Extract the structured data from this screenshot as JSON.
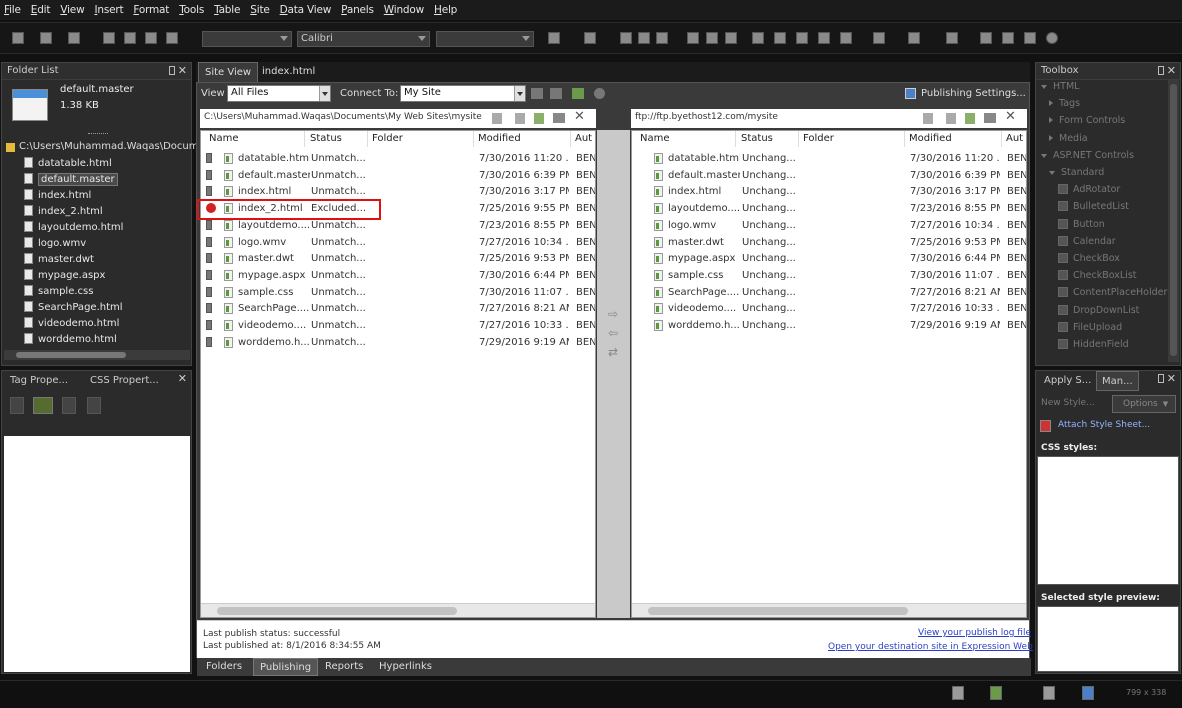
{
  "menu": [
    "File",
    "Edit",
    "View",
    "Insert",
    "Format",
    "Tools",
    "Table",
    "Site",
    "Data View",
    "Panels",
    "Window",
    "Help"
  ],
  "toolbar": {
    "font_name": "Calibri"
  },
  "folder_list": {
    "title": "Folder List",
    "selected_name": "default.master",
    "selected_size": "1.38 KB",
    "root_path": "C:\\Users\\Muhammad.Waqas\\Documents",
    "items": [
      "datatable.html",
      "default.master",
      "index.html",
      "index_2.html",
      "layoutdemo.html",
      "logo.wmv",
      "master.dwt",
      "mypage.aspx",
      "sample.css",
      "SearchPage.html",
      "videodemo.html",
      "worddemo.html"
    ]
  },
  "tag_panel": {
    "tab1": "Tag Prope...",
    "tab2": "CSS Propert..."
  },
  "tabs": {
    "site_view": "Site View",
    "index": "index.html"
  },
  "view_bar": {
    "view_label": "View",
    "view_value": "All Files",
    "connect_label": "Connect To:",
    "connect_value": "My Site",
    "publishing_settings": "Publishing Settings..."
  },
  "local": {
    "path": "C:\\Users\\Muhammad.Waqas\\Documents\\My Web Sites\\mysite",
    "headers": [
      "Name",
      "Status",
      "Folder",
      "Modified",
      "Aut"
    ],
    "rows": [
      {
        "name": "datatable.html",
        "status": "Unmatch...",
        "modified": "7/30/2016 11:20 ...",
        "author": "BEN"
      },
      {
        "name": "default.master",
        "status": "Unmatch...",
        "modified": "7/30/2016 6:39 PM",
        "author": "BEN"
      },
      {
        "name": "index.html",
        "status": "Unmatch...",
        "modified": "7/30/2016 3:17 PM",
        "author": "BEN"
      },
      {
        "name": "index_2.html",
        "status": "Excluded...",
        "modified": "7/25/2016 9:55 PM",
        "author": "BEN"
      },
      {
        "name": "layoutdemo....",
        "status": "Unmatch...",
        "modified": "7/23/2016 8:55 PM",
        "author": "BEN"
      },
      {
        "name": "logo.wmv",
        "status": "Unmatch...",
        "modified": "7/27/2016 10:34 ...",
        "author": "BEN"
      },
      {
        "name": "master.dwt",
        "status": "Unmatch...",
        "modified": "7/25/2016 9:53 PM",
        "author": "BEN"
      },
      {
        "name": "mypage.aspx",
        "status": "Unmatch...",
        "modified": "7/30/2016 6:44 PM",
        "author": "BEN"
      },
      {
        "name": "sample.css",
        "status": "Unmatch...",
        "modified": "7/30/2016 11:07 ...",
        "author": "BEN"
      },
      {
        "name": "SearchPage....",
        "status": "Unmatch...",
        "modified": "7/27/2016 8:21 AM",
        "author": "BEN"
      },
      {
        "name": "videodemo....",
        "status": "Unmatch...",
        "modified": "7/27/2016 10:33 ...",
        "author": "BEN"
      },
      {
        "name": "worddemo.h...",
        "status": "Unmatch...",
        "modified": "7/29/2016 9:19 AM",
        "author": "BEN"
      }
    ]
  },
  "remote": {
    "path": "ftp://ftp.byethost12.com/mysite",
    "headers": [
      "Name",
      "Status",
      "Folder",
      "Modified",
      "Aut"
    ],
    "rows": [
      {
        "name": "datatable.html",
        "status": "Unchang...",
        "modified": "7/30/2016 11:20 ...",
        "author": "BEN"
      },
      {
        "name": "default.master",
        "status": "Unchang...",
        "modified": "7/30/2016 6:39 PM",
        "author": "BEN"
      },
      {
        "name": "index.html",
        "status": "Unchang...",
        "modified": "7/30/2016 3:17 PM",
        "author": "BEN"
      },
      {
        "name": "layoutdemo....",
        "status": "Unchang...",
        "modified": "7/23/2016 8:55 PM",
        "author": "BEN"
      },
      {
        "name": "logo.wmv",
        "status": "Unchang...",
        "modified": "7/27/2016 10:34 ...",
        "author": "BEN"
      },
      {
        "name": "master.dwt",
        "status": "Unchang...",
        "modified": "7/25/2016 9:53 PM",
        "author": "BEN"
      },
      {
        "name": "mypage.aspx",
        "status": "Unchang...",
        "modified": "7/30/2016 6:44 PM",
        "author": "BEN"
      },
      {
        "name": "sample.css",
        "status": "Unchang...",
        "modified": "7/30/2016 11:07 ...",
        "author": "BEN"
      },
      {
        "name": "SearchPage....",
        "status": "Unchang...",
        "modified": "7/27/2016 8:21 AM",
        "author": "BEN"
      },
      {
        "name": "videodemo....",
        "status": "Unchang...",
        "modified": "7/27/2016 10:33 ...",
        "author": "BEN"
      },
      {
        "name": "worddemo.h...",
        "status": "Unchang...",
        "modified": "7/29/2016 9:19 AM",
        "author": "BEN"
      }
    ]
  },
  "publish_info": {
    "status": "Last publish status: successful",
    "published_at": "Last published at: 8/1/2016 8:34:55 AM",
    "view_log": "View your publish log file",
    "open_dest": "Open your destination site in Expression Web"
  },
  "bottom_tabs": [
    "Folders",
    "Publishing",
    "Reports",
    "Hyperlinks"
  ],
  "toolbox": {
    "title": "Toolbox",
    "items": [
      {
        "label": "HTML",
        "kind": "root",
        "expanded": true
      },
      {
        "label": "Tags",
        "kind": "group"
      },
      {
        "label": "Form Controls",
        "kind": "group"
      },
      {
        "label": "Media",
        "kind": "group"
      },
      {
        "label": "ASP.NET Controls",
        "kind": "root",
        "expanded": true
      },
      {
        "label": "Standard",
        "kind": "group",
        "expanded": true
      },
      {
        "label": "AdRotator",
        "kind": "control"
      },
      {
        "label": "BulletedList",
        "kind": "control"
      },
      {
        "label": "Button",
        "kind": "control"
      },
      {
        "label": "Calendar",
        "kind": "control"
      },
      {
        "label": "CheckBox",
        "kind": "control"
      },
      {
        "label": "CheckBoxList",
        "kind": "control"
      },
      {
        "label": "ContentPlaceHolder",
        "kind": "control"
      },
      {
        "label": "DropDownList",
        "kind": "control"
      },
      {
        "label": "FileUpload",
        "kind": "control"
      },
      {
        "label": "HiddenField",
        "kind": "control"
      }
    ]
  },
  "styles_panel": {
    "tab1": "Apply S...",
    "tab2": "Man...",
    "new_style": "New Style...",
    "options": "Options",
    "attach": "Attach Style Sheet...",
    "css_styles": "CSS styles:",
    "preview": "Selected style preview:"
  },
  "status_bar": {
    "dimensions": "799 x 338"
  }
}
